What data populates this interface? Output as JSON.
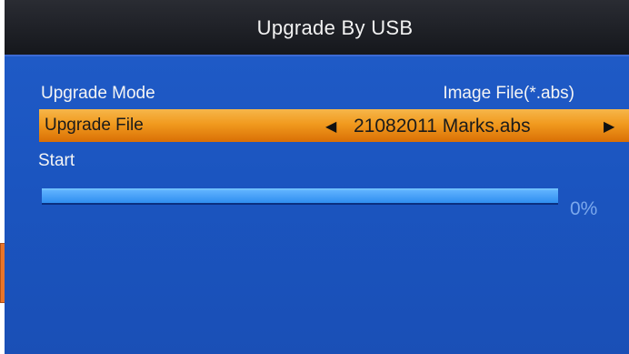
{
  "header": {
    "title": "Upgrade By USB"
  },
  "menu": {
    "upgrade_mode": {
      "label": "Upgrade Mode",
      "value": "Image File(*.abs)"
    },
    "upgrade_file": {
      "label": "Upgrade File",
      "value": "21082011 Marks.abs",
      "arrow_left": "◀",
      "arrow_right": "▶"
    },
    "start": {
      "label": "Start"
    }
  },
  "progress": {
    "fraction": 1.0,
    "text": "0%"
  },
  "colors": {
    "background": "#1a4fb8",
    "highlight": "#f19a1e",
    "title_bar": "#1d1f24",
    "progress_bar": "#3f9bf7"
  }
}
